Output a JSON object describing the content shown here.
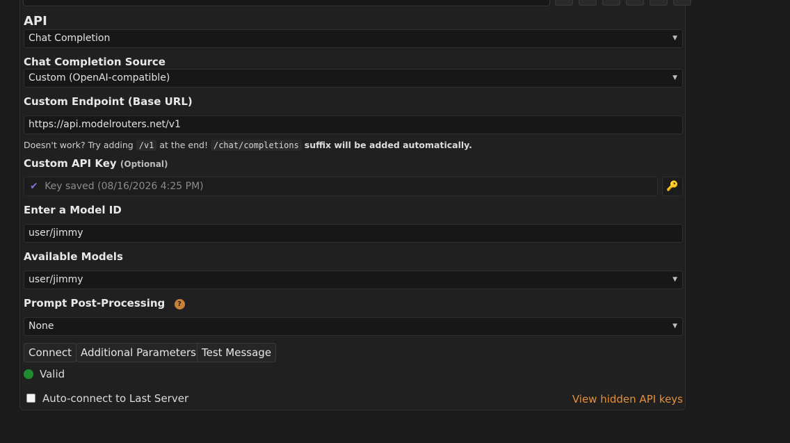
{
  "api": {
    "label": "API",
    "value": "Chat Completion"
  },
  "source": {
    "label": "Chat Completion Source",
    "value": "Custom (OpenAI-compatible)"
  },
  "endpoint": {
    "label": "Custom Endpoint (Base URL)",
    "value": "https://api.modelrouters.net/v1",
    "hint_prefix": "Doesn't work? Try adding",
    "hint_code1": "/v1",
    "hint_middle": "at the end!",
    "hint_code2": "/chat/completions",
    "hint_suffix": "suffix will be added automatically."
  },
  "api_key": {
    "label": "Custom API Key",
    "optional": "(Optional)",
    "placeholder": "Key saved (08/16/2026 4:25 PM)",
    "check_icon": "✔",
    "key_icon": "🔑"
  },
  "model_id": {
    "label": "Enter a Model ID",
    "value": "user/jimmy"
  },
  "available_models": {
    "label": "Available Models",
    "value": "user/jimmy"
  },
  "post_processing": {
    "label": "Prompt Post-Processing",
    "help_icon": "?",
    "value": "None"
  },
  "buttons": {
    "connect": "Connect",
    "additional": "Additional Parameters",
    "test": "Test Message"
  },
  "status": {
    "text": "Valid",
    "color": "#1f8a2e"
  },
  "auto_connect": {
    "label": "Auto-connect to Last Server",
    "checked": false
  },
  "hidden_keys_link": "View hidden API keys",
  "colors": {
    "accent_link": "#e4913a",
    "check_icon": "#8a6fd8",
    "help_icon": "#c9813a"
  }
}
